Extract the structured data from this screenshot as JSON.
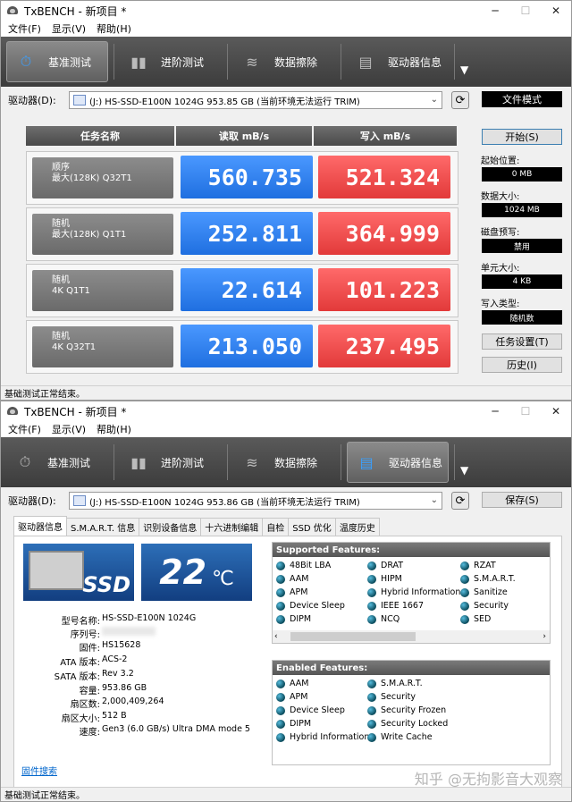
{
  "window1": {
    "title": "TxBENCH - 新项目 *",
    "menu": [
      "文件(F)",
      "显示(V)",
      "帮助(H)"
    ],
    "toolbar": [
      {
        "label": "基准测试",
        "icon": "stopwatch-icon",
        "active": true
      },
      {
        "label": "进阶测试",
        "icon": "bar-chart-icon",
        "active": false
      },
      {
        "label": "数据擦除",
        "icon": "eraser-icon",
        "active": false
      },
      {
        "label": "驱动器信息",
        "icon": "drive-info-icon",
        "active": false
      }
    ],
    "drive_label": "驱动器(D):",
    "drive_value": "(J:) HS-SSD-E100N 1024G  953.85 GB (当前环境无法运行 TRIM)",
    "mode_button": "文件模式",
    "headers": {
      "task": "任务名称",
      "read": "读取 mB/s",
      "write": "写入 mB/s"
    },
    "rows": [
      {
        "line1": "顺序",
        "line2": "最大(128K) Q32T1",
        "read": "560.735",
        "write": "521.324"
      },
      {
        "line1": "随机",
        "line2": "最大(128K) Q1T1",
        "read": "252.811",
        "write": "364.999"
      },
      {
        "line1": "随机",
        "line2": "4K Q1T1",
        "read": "22.614",
        "write": "101.223"
      },
      {
        "line1": "随机",
        "line2": "4K Q32T1",
        "read": "213.050",
        "write": "237.495"
      }
    ],
    "start_button": "开始(S)",
    "settings": [
      {
        "label": "起始位置:",
        "value": "0 MB"
      },
      {
        "label": "数据大小:",
        "value": "1024 MB"
      },
      {
        "label": "磁盘预写:",
        "value": "禁用"
      },
      {
        "label": "单元大小:",
        "value": "4 KB"
      },
      {
        "label": "写入类型:",
        "value": "随机数"
      }
    ],
    "task_settings_button": "任务设置(T)",
    "history_button": "历史(I)",
    "status": "基础测试正常结束。"
  },
  "window2": {
    "title": "TxBENCH - 新项目 *",
    "menu": [
      "文件(F)",
      "显示(V)",
      "帮助(H)"
    ],
    "toolbar": [
      {
        "label": "基准测试",
        "icon": "stopwatch-icon",
        "active": false
      },
      {
        "label": "进阶测试",
        "icon": "bar-chart-icon",
        "active": false
      },
      {
        "label": "数据擦除",
        "icon": "eraser-icon",
        "active": false
      },
      {
        "label": "驱动器信息",
        "icon": "drive-info-icon",
        "active": true
      }
    ],
    "drive_label": "驱动器(D):",
    "drive_value": "(J:) HS-SSD-E100N 1024G  953.86 GB (当前环境无法运行 TRIM)",
    "save_button": "保存(S)",
    "tabs": [
      "驱动器信息",
      "S.M.A.R.T. 信息",
      "识别设备信息",
      "十六进制编辑",
      "自检",
      "SSD 优化",
      "温度历史"
    ],
    "ssd_badge": "SSD",
    "temperature": "22",
    "temperature_unit": "℃",
    "info": [
      {
        "key": "型号名称:",
        "value": "HS-SSD-E100N 1024G"
      },
      {
        "key": "序列号:",
        "value": ""
      },
      {
        "key": "固件:",
        "value": "HS15628"
      },
      {
        "key": "ATA 版本:",
        "value": "ACS-2"
      },
      {
        "key": "SATA 版本:",
        "value": "Rev 3.2"
      },
      {
        "key": "容量:",
        "value": "953.86 GB"
      },
      {
        "key": "扇区数:",
        "value": "2,000,409,264"
      },
      {
        "key": "扇区大小:",
        "value": "512 B"
      },
      {
        "key": "速度:",
        "value": "Gen3 (6.0 GB/s)  Ultra DMA mode 5"
      }
    ],
    "supported_title": "Supported Features:",
    "supported": [
      "48Bit LBA",
      "DRAT",
      "RZAT",
      "AAM",
      "HIPM",
      "S.M.A.R.T.",
      "APM",
      "Hybrid Information",
      "Sanitize",
      "Device Sleep",
      "IEEE 1667",
      "Security",
      "DIPM",
      "NCQ",
      "SED"
    ],
    "enabled_title": "Enabled Features:",
    "enabled": [
      "AAM",
      "S.M.A.R.T.",
      "APM",
      "Security",
      "Device Sleep",
      "Security Frozen",
      "DIPM",
      "Security Locked",
      "Hybrid Information",
      "Write Cache"
    ],
    "firmware_link": "固件搜索",
    "status": "基础测试正常结束。",
    "watermark": "知乎 @无拘影音大观察"
  }
}
